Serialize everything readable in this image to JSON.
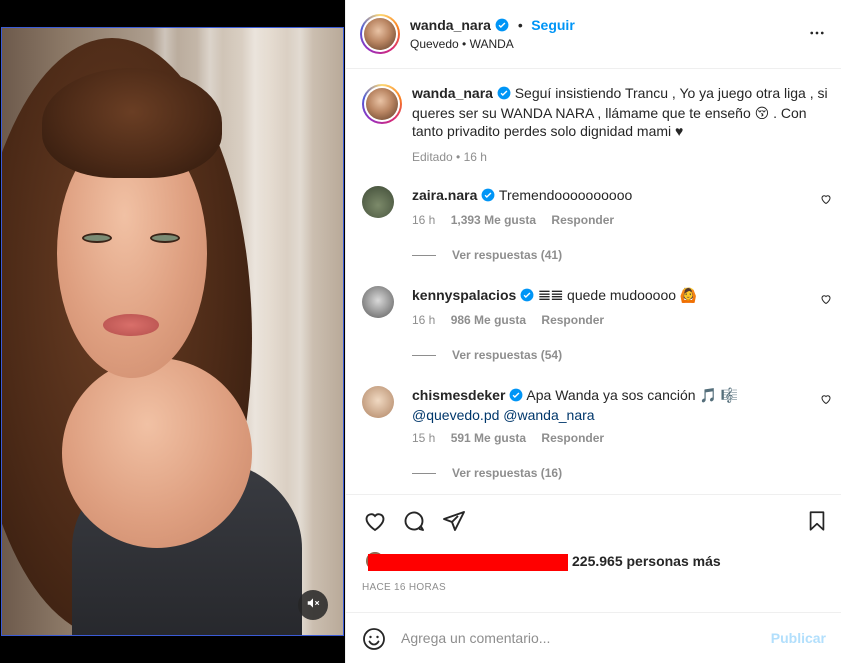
{
  "post": {
    "username": "wanda_nara",
    "follow_label": "Seguir",
    "separator": "•",
    "location": "Quevedo • WANDA"
  },
  "caption": {
    "username": "wanda_nara",
    "text": "Seguí insistiendo Trancu , Yo ya juego otra liga , si queres ser su WANDA NARA , llámame que te enseño 😚 . Con tanto privadito perdes solo dignidad mami ♥",
    "meta": "Editado • 16 h"
  },
  "comments": [
    {
      "username": "zaira.nara",
      "text": "Tremendoooooooooo",
      "mention1": "",
      "mention2": "",
      "time": "16 h",
      "likes": "1,393 Me gusta",
      "reply_label": "Responder",
      "view_replies": "Ver respuestas (41)"
    },
    {
      "username": "kennyspalacios",
      "text": "𝌆𝌆 quede mudooooo 🙆",
      "mention1": "",
      "mention2": "",
      "time": "16 h",
      "likes": "986 Me gusta",
      "reply_label": "Responder",
      "view_replies": "Ver respuestas (54)"
    },
    {
      "username": "chismesdeker",
      "text": "Apa Wanda ya sos canción 🎵 🎼",
      "mention1": "@quevedo.pd",
      "mention2": "@wanda_nara",
      "time": "15 h",
      "likes": "591 Me gusta",
      "reply_label": "Responder",
      "view_replies": "Ver respuestas (16)"
    }
  ],
  "likes": {
    "text": "225.965 personas más"
  },
  "timestamp": "HACE 16 HORAS",
  "composer": {
    "placeholder": "Agrega un comentario...",
    "publish_label": "Publicar"
  },
  "colors": {
    "accent": "#0095f6",
    "verified": "#0095f6",
    "redaction": "#ff0000",
    "muted_text": "#8e8e8e",
    "publish_disabled": "#b2dffc"
  },
  "icons": [
    "mute-icon",
    "more-icon",
    "verified-icon",
    "heart-icon",
    "comment-icon",
    "share-icon",
    "bookmark-icon",
    "emoji-icon"
  ]
}
